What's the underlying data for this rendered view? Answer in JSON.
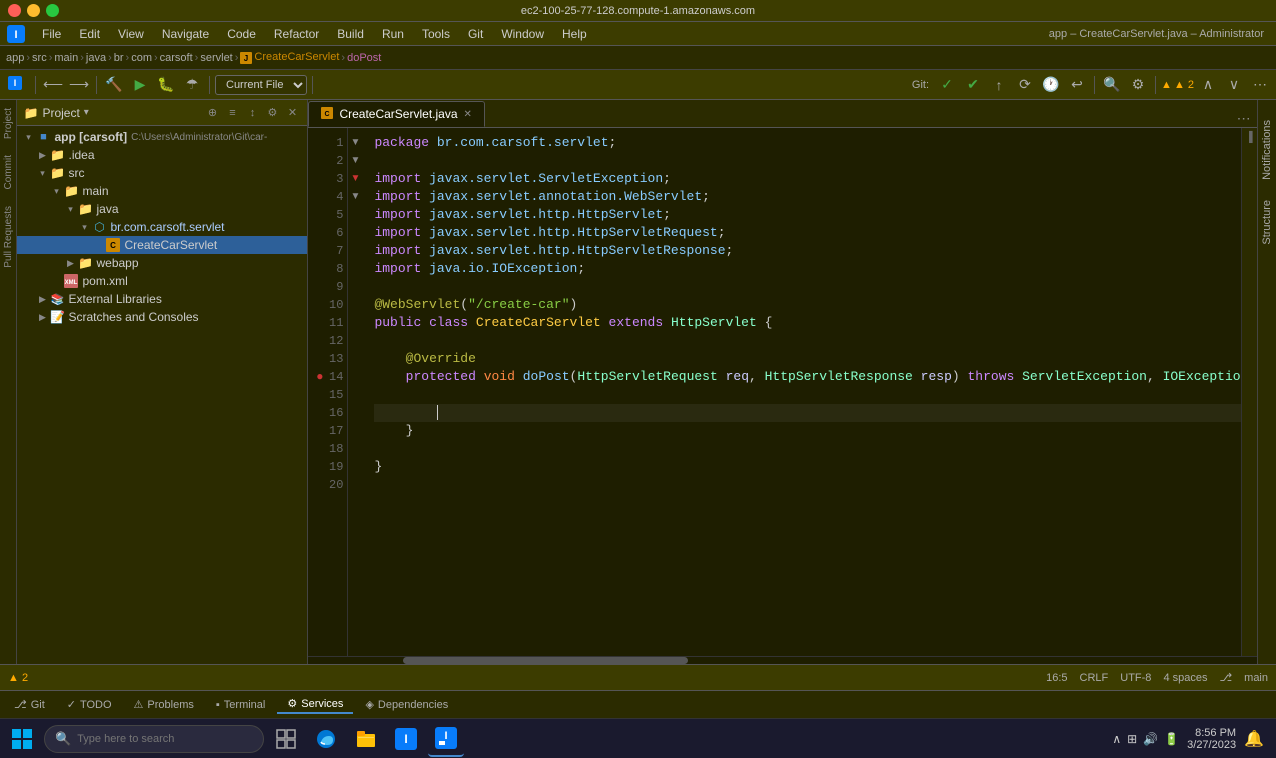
{
  "window": {
    "title": "ec2-100-25-77-128.compute-1.amazonaws.com",
    "app_title": "app – CreateCarServlet.java – Administrator"
  },
  "menu": {
    "items": [
      "File",
      "Edit",
      "View",
      "Navigate",
      "Code",
      "Refactor",
      "Build",
      "Run",
      "Tools",
      "Git",
      "Window",
      "Help"
    ]
  },
  "breadcrumb": {
    "items": [
      "app",
      "src",
      "main",
      "java",
      "br",
      "com",
      "carsoft",
      "servlet"
    ],
    "file": "CreateCarServlet",
    "method": "doPost"
  },
  "toolbar": {
    "dropdown_label": "Current File"
  },
  "project": {
    "title": "Project",
    "root": "app [carsoft]",
    "root_path": "C:\\Users\\Administrator\\Git\\car-",
    "tree": [
      {
        "id": "app",
        "label": "app [carsoft]",
        "indent": 0,
        "type": "root",
        "expanded": true
      },
      {
        "id": "idea",
        "label": ".idea",
        "indent": 1,
        "type": "folder",
        "expanded": false
      },
      {
        "id": "src",
        "label": "src",
        "indent": 1,
        "type": "folder",
        "expanded": true
      },
      {
        "id": "main",
        "label": "main",
        "indent": 2,
        "type": "folder",
        "expanded": true
      },
      {
        "id": "java",
        "label": "java",
        "indent": 3,
        "type": "folder",
        "expanded": true
      },
      {
        "id": "br.com.carsoft.servlet",
        "label": "br.com.carsoft.servlet",
        "indent": 4,
        "type": "package",
        "expanded": true
      },
      {
        "id": "CreateCarServlet",
        "label": "CreateCarServlet",
        "indent": 5,
        "type": "java",
        "selected": true
      },
      {
        "id": "webapp",
        "label": "webapp",
        "indent": 3,
        "type": "folder",
        "expanded": false
      },
      {
        "id": "pom.xml",
        "label": "pom.xml",
        "indent": 2,
        "type": "xml"
      },
      {
        "id": "external",
        "label": "External Libraries",
        "indent": 1,
        "type": "folder",
        "expanded": false
      },
      {
        "id": "scratches",
        "label": "Scratches and Consoles",
        "indent": 1,
        "type": "folder",
        "expanded": false
      }
    ]
  },
  "editor": {
    "tab": "CreateCarServlet.java",
    "code_lines": [
      {
        "num": 1,
        "text": "package br.com.carsoft.servlet;"
      },
      {
        "num": 2,
        "text": ""
      },
      {
        "num": 3,
        "text": "import javax.servlet.ServletException;"
      },
      {
        "num": 4,
        "text": "import javax.servlet.annotation.WebServlet;"
      },
      {
        "num": 5,
        "text": "import javax.servlet.http.HttpServlet;"
      },
      {
        "num": 6,
        "text": "import javax.servlet.http.HttpServletRequest;"
      },
      {
        "num": 7,
        "text": "import javax.servlet.http.HttpServletResponse;"
      },
      {
        "num": 8,
        "text": "import java.io.IOException;"
      },
      {
        "num": 9,
        "text": ""
      },
      {
        "num": 10,
        "text": "@WebServlet(\"/create-car\")"
      },
      {
        "num": 11,
        "text": "public class CreateCarServlet extends HttpServlet {"
      },
      {
        "num": 12,
        "text": ""
      },
      {
        "num": 13,
        "text": "    @Override"
      },
      {
        "num": 14,
        "text": "    protected void doPost(HttpServletRequest req, HttpServletResponse resp) throws ServletException, IOExceptio"
      },
      {
        "num": 15,
        "text": ""
      },
      {
        "num": 16,
        "text": "        |"
      },
      {
        "num": 17,
        "text": "    }"
      },
      {
        "num": 18,
        "text": ""
      },
      {
        "num": 19,
        "text": "}"
      },
      {
        "num": 20,
        "text": ""
      }
    ]
  },
  "status_bar": {
    "git": "Git",
    "warnings": "▲ 2",
    "position": "16:5",
    "line_ending": "CRLF",
    "encoding": "UTF-8",
    "indent": "4 spaces",
    "branch": "main"
  },
  "bottom_tabs": [
    {
      "id": "git",
      "label": "Git",
      "icon": "git-icon"
    },
    {
      "id": "todo",
      "label": "TODO",
      "icon": "todo-icon"
    },
    {
      "id": "problems",
      "label": "Problems",
      "icon": "problems-icon"
    },
    {
      "id": "terminal",
      "label": "Terminal",
      "icon": "terminal-icon"
    },
    {
      "id": "services",
      "label": "Services",
      "icon": "services-icon"
    },
    {
      "id": "dependencies",
      "label": "Dependencies",
      "icon": "dependencies-icon"
    }
  ],
  "taskbar": {
    "search_placeholder": "Type here to search",
    "apps": [
      {
        "id": "taskview",
        "icon": "⊞"
      },
      {
        "id": "edge",
        "icon": "⬡"
      },
      {
        "id": "explorer",
        "icon": "📁"
      },
      {
        "id": "intellij-alt",
        "icon": "◈"
      },
      {
        "id": "intellij",
        "icon": "◉"
      }
    ],
    "clock": "8:56 PM",
    "date": "3/27/2023"
  },
  "side_panels": {
    "left": [
      "Commit",
      "Pull Requests"
    ],
    "right": [
      "Notifications",
      "Structure"
    ]
  },
  "colors": {
    "bg_dark": "#1e1e00",
    "bg_mid": "#2b2b00",
    "bg_light": "#3c3c00",
    "accent_blue": "#4488cc",
    "accent_orange": "#cc8800",
    "keyword": "#cc88ff",
    "string": "#88cc44",
    "annotation": "#bbbb44"
  }
}
